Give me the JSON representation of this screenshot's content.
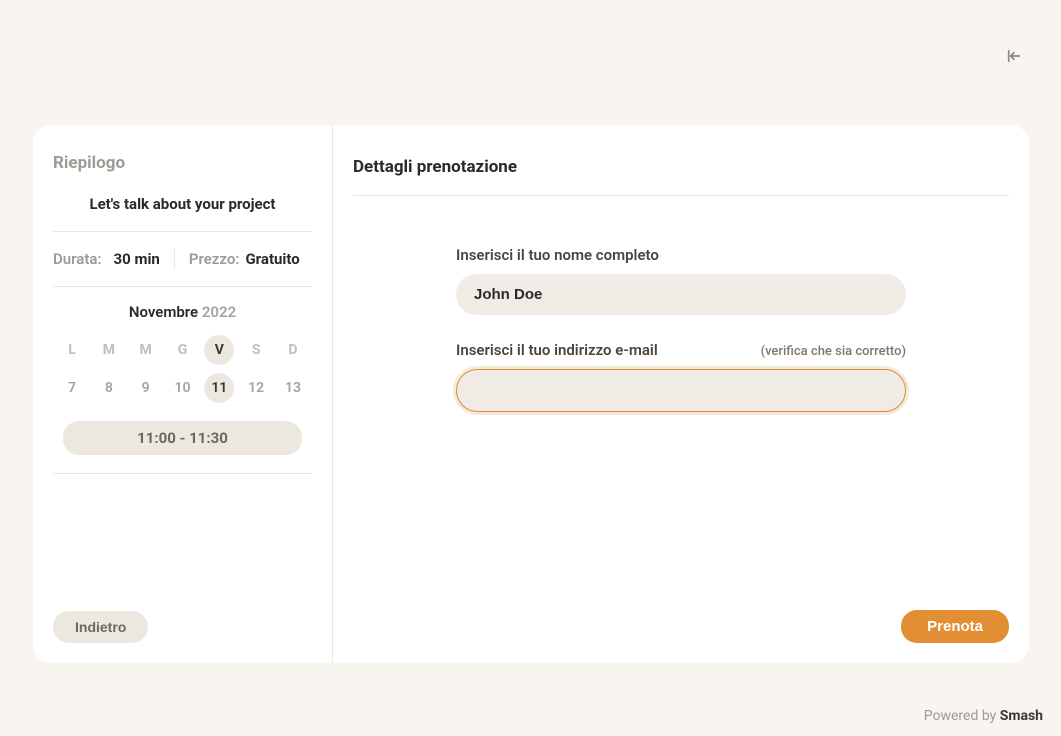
{
  "close_icon": "collapse-icon",
  "sidebar": {
    "title": "Riepilogo",
    "project_title": "Let's talk about your project",
    "duration_label": "Durata:",
    "duration_value": "30 min",
    "price_label": "Prezzo:",
    "price_value": "Gratuito",
    "month_name": "Novembre",
    "month_year": "2022",
    "weekday_headers": [
      "L",
      "M",
      "M",
      "G",
      "V",
      "S",
      "D"
    ],
    "week_dates": [
      "7",
      "8",
      "9",
      "10",
      "11",
      "12",
      "13"
    ],
    "selected_index": 4,
    "time_slot": "11:00 - 11:30",
    "back_label": "Indietro"
  },
  "main": {
    "title": "Dettagli prenotazione",
    "name_label": "Inserisci il tuo nome completo",
    "name_value": "John Doe",
    "email_label": "Inserisci il tuo indirizzo e-mail",
    "email_hint": "(verifica che sia corretto)",
    "email_value": "",
    "book_label": "Prenota"
  },
  "footer": {
    "prefix": "Powered by ",
    "brand": "Smash"
  }
}
